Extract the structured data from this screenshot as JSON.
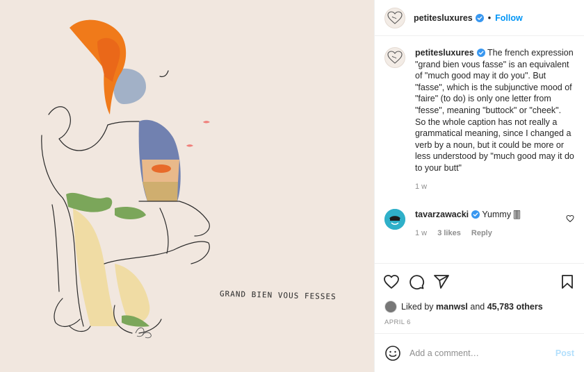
{
  "post": {
    "author": "petitesluxures",
    "artwork_caption": "GRAND BIEN VOUS FESSES",
    "artwork_signature": "Petites Luxures",
    "header": {
      "username": "petitesluxures",
      "separator": "•",
      "follow_label": "Follow"
    },
    "caption": {
      "username": "petitesluxures",
      "text": "The french expression \"grand bien vous fasse\" is an equivalent of \"much good may it do you\". But \"fasse\", which is the subjunctive mood of \"faire\" (to do) is only one letter from \"fesse\", meaning \"buttock\" or \"cheek\".\nSo the whole caption has not really a grammatical meaning, since I changed a verb by a noun, but it could be more or less understood by \"much good may it do to your butt\"",
      "time": "1 w"
    },
    "comments": [
      {
        "username": "tavarzawacki",
        "text": "Yummy 🀫",
        "time": "1 w",
        "likes": "3 likes",
        "reply_label": "Reply"
      }
    ],
    "likes": {
      "prefix": "Liked by",
      "liker": "manwsl",
      "connector": "and",
      "others": "45,783 others"
    },
    "date": "APRIL 6",
    "add_comment": {
      "placeholder": "Add a comment…",
      "post_label": "Post"
    },
    "icons": {
      "like": "heart-icon",
      "comment": "comment-icon",
      "share": "share-icon",
      "save": "bookmark-icon",
      "emoji": "emoji-icon",
      "verified": "verified-badge-icon"
    },
    "colors": {
      "accent": "#0095f6",
      "verified": "#3897f0",
      "post_disabled": "#b2dffc",
      "canvas": "#f1e7df",
      "hair": "#f07a1a"
    }
  }
}
